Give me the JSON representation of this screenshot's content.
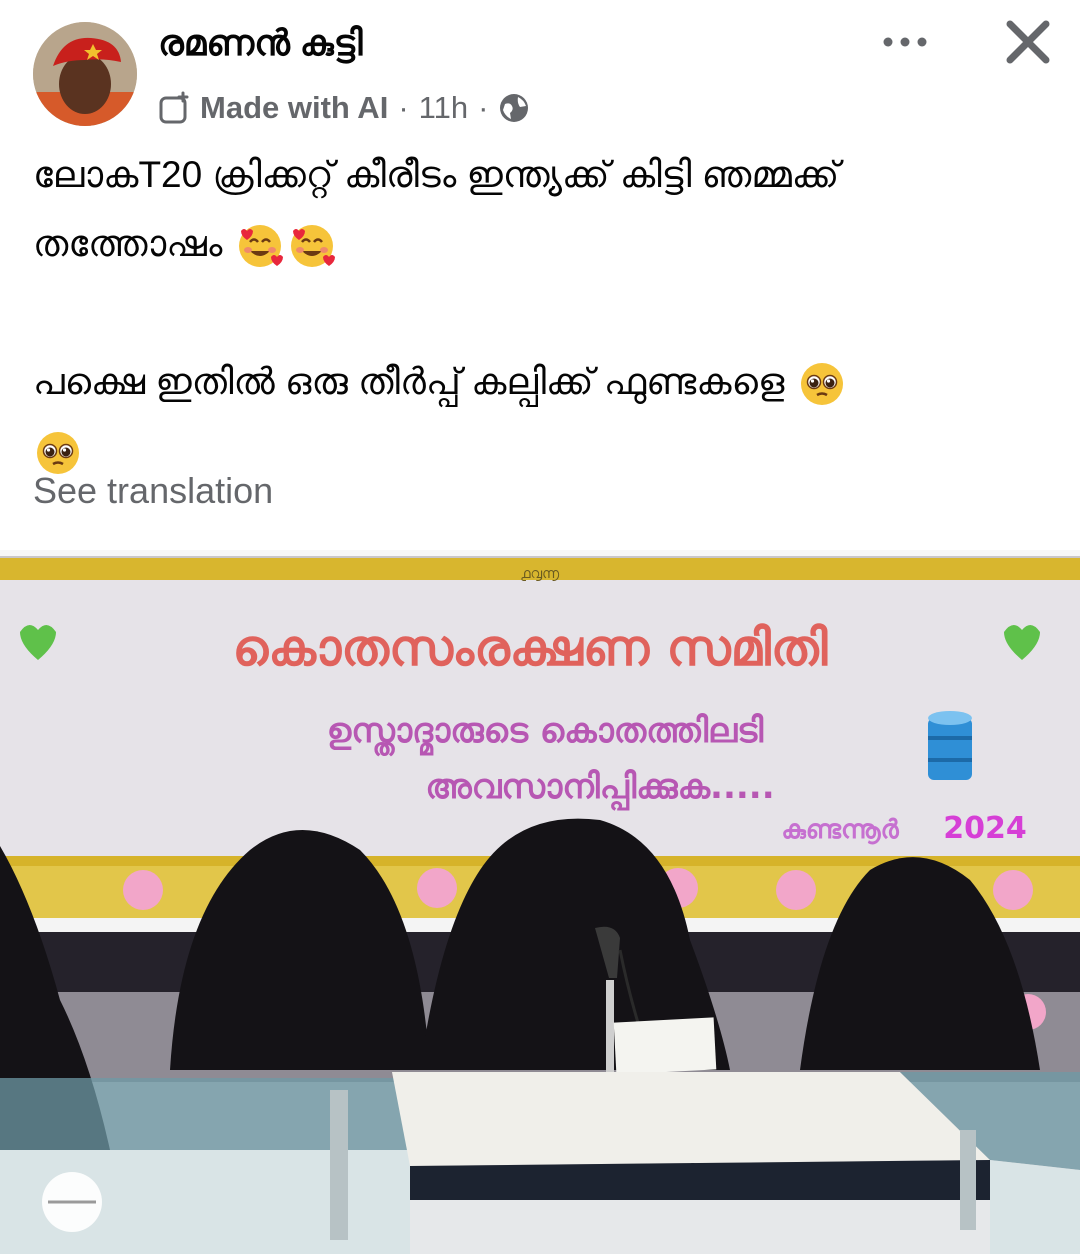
{
  "header": {
    "author_name": "രമണൻ കുട്ടി",
    "ai_label": "Made with AI",
    "separator": "·",
    "timestamp": "11h",
    "privacy_icon": "globe-icon",
    "more_icon": "more-horizontal-icon",
    "close_icon": "close-icon"
  },
  "post": {
    "line1": "ലോകT20 ക്രിക്കറ്റ് കീരീടം ഇന്ത്യക്ക് കിട്ടി ഞമ്മക്ക്",
    "line2": "തത്തോഷം",
    "line3": "പക്ഷെ ഇതിൽ ഒരു തീർപ്പ് കല്പിക്ക് ഫുണ്ടകളെ",
    "emoji_hearts": "smiling-face-with-hearts",
    "emoji_pleading": "pleading-face",
    "see_translation": "See translation"
  },
  "image": {
    "banner_top": "൧൮൬",
    "banner_title": "കൊതസംരക്ഷണ സമിതി",
    "banner_line1": "ഉസ്താദ്മാരുടെ കൊതത്തിലടി",
    "banner_line2": "അവസാനിപ്പിക്കുക.....",
    "banner_place": "കുണ്ടന്നൂർ",
    "banner_year": "2024",
    "colors": {
      "banner_title": "#e0625c",
      "banner_sub": "#b757b3",
      "year": "#d63fd6",
      "heart": "#5fc14a",
      "gold": "#d7b328"
    }
  }
}
